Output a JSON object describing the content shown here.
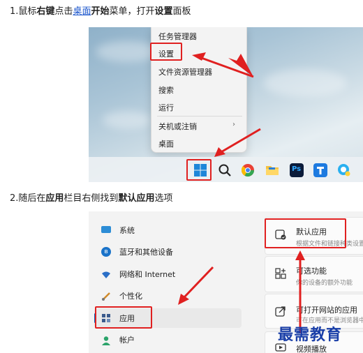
{
  "step1": {
    "prefix": "1.鼠标",
    "b1": "右键",
    "t2": "点击",
    "link": "桌面",
    "b2": "开始",
    "t3": "菜单，打开",
    "b3": "设置",
    "t4": "面板"
  },
  "step2": {
    "prefix": "2.随后在",
    "b1": "应用",
    "t2": "栏目右侧找到",
    "b2": "默认应用",
    "t3": "选项"
  },
  "context_menu": {
    "items": [
      "任务管理器",
      "设置",
      "文件资源管理器",
      "搜索",
      "运行",
      "关机或注销",
      "桌面"
    ],
    "submenu_arrow": "›"
  },
  "taskbar": {
    "icons": [
      "windows-start-icon",
      "search-icon",
      "chrome-icon",
      "file-explorer-icon",
      "photoshop-icon",
      "browser-icon",
      "messenger-icon"
    ],
    "ps_label": "Ps"
  },
  "settings": {
    "sidebar": [
      "系统",
      "蓝牙和其他设备",
      "网络和 Internet",
      "个性化",
      "应用",
      "帐户"
    ],
    "cards": [
      {
        "title": "默认应用",
        "desc": "根据文件和链接种类设置"
      },
      {
        "title": "可选功能",
        "desc": "你的设备的额外功能"
      },
      {
        "title": "可打开网站的应用",
        "desc": "可在应用而不是浏览器中"
      },
      {
        "title": "视频播放",
        "desc": ""
      }
    ]
  },
  "watermark": "最需教育",
  "colors": {
    "highlight": "#e02020",
    "accent": "#0067c0",
    "link": "#1a55cc"
  }
}
